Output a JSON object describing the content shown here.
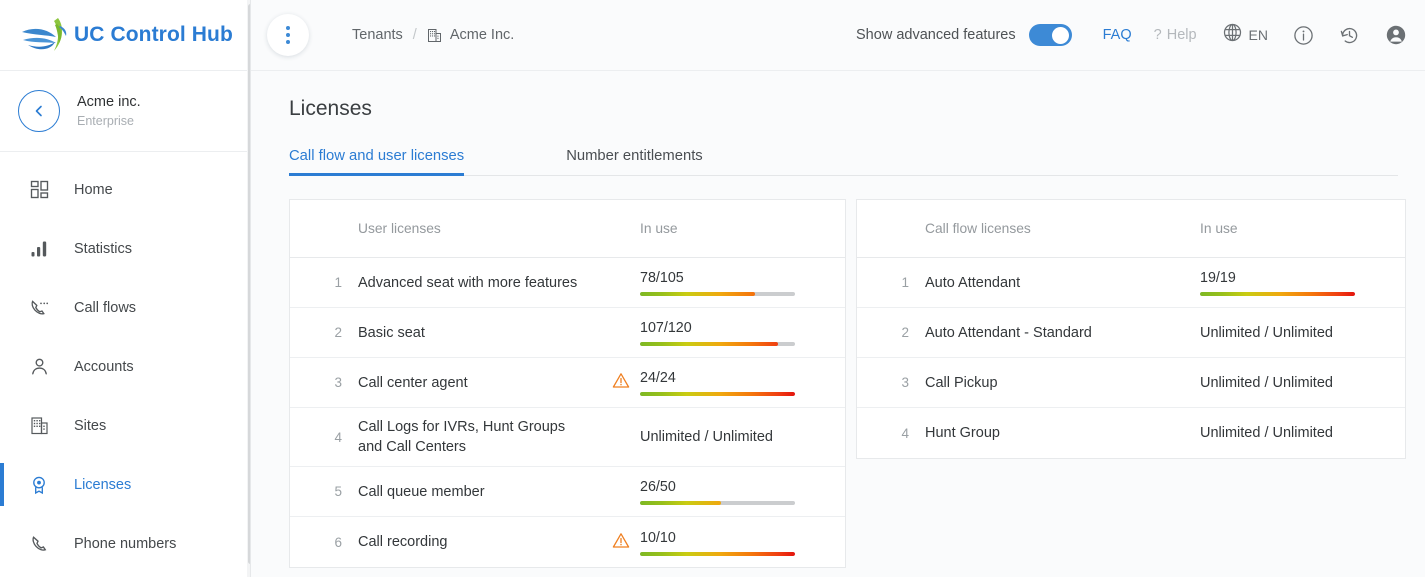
{
  "brand": {
    "title": "UC Control Hub",
    "logo_icon": "bird-swoosh-logo"
  },
  "tenant": {
    "name": "Acme inc.",
    "plan": "Enterprise",
    "back_icon": "chevron-left-icon"
  },
  "sidebar": {
    "items": [
      {
        "label": "Home",
        "icon": "dashboard-grid-icon",
        "active": false
      },
      {
        "label": "Statistics",
        "icon": "bar-chart-icon",
        "active": false
      },
      {
        "label": "Call flows",
        "icon": "phone-dots-icon",
        "active": false
      },
      {
        "label": "Accounts",
        "icon": "person-icon",
        "active": false
      },
      {
        "label": "Sites",
        "icon": "building-icon",
        "active": false
      },
      {
        "label": "Licenses",
        "icon": "award-badge-icon",
        "active": true
      },
      {
        "label": "Phone numbers",
        "icon": "phone-icon",
        "active": false
      }
    ]
  },
  "topbar": {
    "menu_icon": "vertical-dots-icon",
    "breadcrumb": {
      "root": "Tenants",
      "separator": "/",
      "current": "Acme Inc.",
      "current_icon": "building-icon"
    },
    "advanced_features_label": "Show advanced features",
    "advanced_features_on": true,
    "faq_label": "FAQ",
    "help_label": "Help",
    "help_prefix": "?",
    "language": "EN",
    "globe_icon": "globe-icon",
    "info_icon": "info-circle-icon",
    "history_icon": "history-clock-icon",
    "account_icon": "user-avatar-icon"
  },
  "page": {
    "title": "Licenses"
  },
  "tabs": [
    {
      "label": "Call flow and user licenses",
      "active": true
    },
    {
      "label": "Number entitlements",
      "active": false
    }
  ],
  "user_licenses": {
    "header": {
      "name": "User licenses",
      "in_use": "In use"
    },
    "rows": [
      {
        "idx": "1",
        "name": "Advanced seat with more features",
        "in_use": "78/105",
        "used": 78,
        "total": 105,
        "percent": 74,
        "warning": false,
        "unlimited": false
      },
      {
        "idx": "2",
        "name": "Basic seat",
        "in_use": "107/120",
        "used": 107,
        "total": 120,
        "percent": 89,
        "warning": false,
        "unlimited": false
      },
      {
        "idx": "3",
        "name": "Call center agent",
        "in_use": "24/24",
        "used": 24,
        "total": 24,
        "percent": 100,
        "warning": true,
        "unlimited": false
      },
      {
        "idx": "4",
        "name": "Call Logs for IVRs, Hunt Groups and Call Centers",
        "in_use": "Unlimited / Unlimited",
        "warning": false,
        "unlimited": true
      },
      {
        "idx": "5",
        "name": "Call queue member",
        "in_use": "26/50",
        "used": 26,
        "total": 50,
        "percent": 52,
        "warning": false,
        "unlimited": false
      },
      {
        "idx": "6",
        "name": "Call recording",
        "in_use": "10/10",
        "used": 10,
        "total": 10,
        "percent": 100,
        "warning": true,
        "unlimited": false
      }
    ]
  },
  "call_flow_licenses": {
    "header": {
      "name": "Call flow licenses",
      "in_use": "In use"
    },
    "rows": [
      {
        "idx": "1",
        "name": "Auto Attendant",
        "in_use": "19/19",
        "used": 19,
        "total": 19,
        "percent": 100,
        "warning": false,
        "unlimited": false
      },
      {
        "idx": "2",
        "name": "Auto Attendant - Standard",
        "in_use": "Unlimited / Unlimited",
        "warning": false,
        "unlimited": true
      },
      {
        "idx": "3",
        "name": "Call Pickup",
        "in_use": "Unlimited / Unlimited",
        "warning": false,
        "unlimited": true
      },
      {
        "idx": "4",
        "name": "Hunt Group",
        "in_use": "Unlimited / Unlimited",
        "warning": false,
        "unlimited": true
      }
    ]
  },
  "colors": {
    "accent": "#2b7cd3",
    "toggle_on": "#3d8ad6",
    "warning": "#ef8022",
    "bar_start": "#7db824",
    "bar_end": "#e4130d",
    "bar_track": "#cbcdcf"
  }
}
